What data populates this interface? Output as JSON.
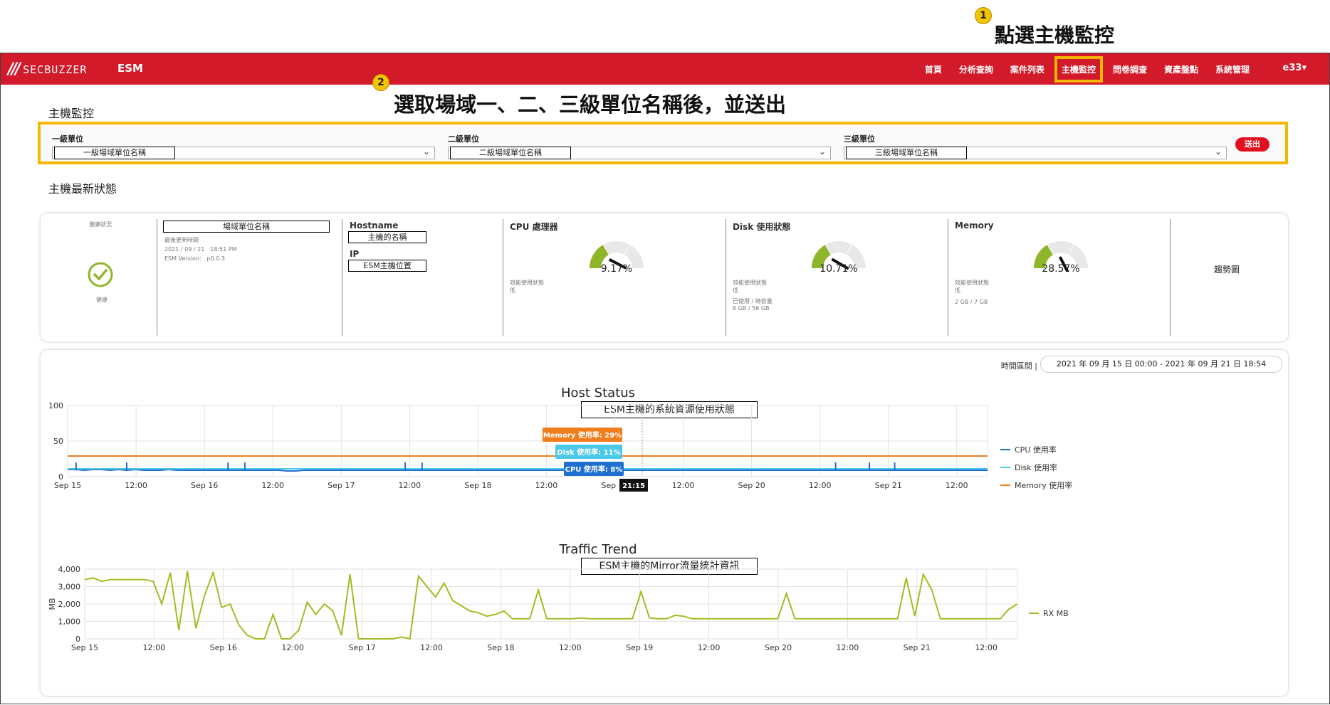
{
  "callouts": {
    "step1": {
      "num": "1",
      "text": "點選主機監控"
    },
    "step2": {
      "num": "2",
      "text": "選取場域一、二、三級單位名稱後，並送出"
    }
  },
  "header": {
    "logo_mark": "///",
    "logo_text": "SECBUZZER",
    "app_name": "ESM",
    "nav": [
      "首頁",
      "分析查詢",
      "案件列表",
      "主機監控",
      "問卷調查",
      "資產盤點",
      "系統管理"
    ],
    "active_nav": "主機監控",
    "user": "e33",
    "brand_color": "#d21a2a"
  },
  "page": {
    "title": "主機監控",
    "status_title": "主機最新狀態"
  },
  "filters": {
    "level1": {
      "label": "一級單位",
      "value": "一級場域單位名稱"
    },
    "level2": {
      "label": "二級單位",
      "value": "二級場域單位名稱"
    },
    "level3": {
      "label": "三級單位",
      "value": "三級場域單位名稱"
    },
    "submit": "送出"
  },
  "status": {
    "health_label": "健康狀況",
    "health_value": "健康",
    "unit_name": "場域單位名稱",
    "last_update_label": "最後更新時間",
    "last_update": "2021 / 09 / 21　18:51 PM",
    "esm_version": "ESM Version： p0.0.3",
    "hostname_label": "Hostname",
    "hostname_value": "主機的名稱",
    "ip_label": "IP",
    "ip_value": "ESM主機位置",
    "cpu": {
      "label": "CPU 處理器",
      "value": "9.17%",
      "percent": 9.17,
      "eff_label": "效能使用狀態",
      "eff_value": "低"
    },
    "disk": {
      "label": "Disk 使用狀態",
      "value": "10.71%",
      "percent": 10.71,
      "eff_label": "效能使用狀態",
      "eff_value": "低",
      "usage_label": "已使用 / 總容量",
      "usage_value": "6 GB / 56 GB"
    },
    "memory": {
      "label": "Memory",
      "value": "28.57%",
      "percent": 28.57,
      "eff_label": "效能使用狀態",
      "eff_value": "低",
      "usage_value": "2 GB / 7 GB"
    },
    "trend": "趨勢圖"
  },
  "range": {
    "label": "時間區間",
    "value": "2021 年 09 月 15 日 00:00 - 2021 年 09 月 21 日 18:54"
  },
  "chart_data": [
    {
      "type": "line",
      "title": "Host Status",
      "subtitle": "ESM主機的系統資源使用狀態",
      "x_ticks": [
        "Sep 15",
        "12:00",
        "Sep 16",
        "12:00",
        "Sep 17",
        "12:00",
        "Sep 18",
        "12:00",
        "Sep 19",
        "12:00",
        "Sep 20",
        "12:00",
        "Sep 21",
        "12:00"
      ],
      "ylim": [
        0,
        100
      ],
      "y_ticks": [
        "0",
        "50",
        "100"
      ],
      "grid": true,
      "legend": "right",
      "series": [
        {
          "name": "CPU 使用率",
          "color": "#1f6fd1",
          "values": [
            10,
            10,
            9,
            10,
            10,
            9,
            10,
            9,
            10,
            9,
            9,
            9,
            10,
            9,
            9,
            9,
            9,
            9,
            9,
            9,
            9,
            9,
            9,
            9,
            9,
            9,
            8,
            8,
            9,
            9,
            9,
            9,
            9,
            9,
            9,
            9,
            9,
            9,
            9,
            9,
            9,
            9,
            9,
            9,
            9,
            9,
            9,
            9,
            9,
            9,
            9,
            9,
            9,
            9,
            9,
            9,
            9,
            9,
            9,
            9,
            9,
            9,
            9,
            9,
            9,
            9,
            9,
            9,
            9,
            9,
            9,
            9,
            9,
            9,
            9,
            9,
            9,
            9,
            9,
            9,
            9,
            9,
            9,
            9,
            9,
            9,
            9,
            9,
            9,
            9,
            9,
            9,
            9,
            9,
            9,
            9,
            9,
            9,
            9,
            9,
            9,
            9,
            9,
            9,
            9,
            9,
            9,
            9,
            9,
            9
          ]
        },
        {
          "name": "Disk 使用率",
          "color": "#4cc8e8",
          "values": [
            11,
            11,
            11,
            11,
            11,
            11,
            11,
            11,
            11,
            11,
            11,
            11,
            11,
            11,
            11,
            11,
            11,
            11,
            11,
            11,
            11,
            11,
            11,
            11,
            11,
            11,
            11,
            11,
            11,
            11,
            11,
            11,
            11,
            11,
            11,
            11,
            11,
            11,
            11,
            11,
            11,
            11,
            11,
            11,
            11,
            11,
            11,
            11,
            11,
            11,
            11,
            11,
            11,
            11,
            11,
            11,
            11,
            11,
            11,
            11,
            11,
            11,
            11,
            11,
            11,
            11,
            11,
            11,
            11,
            11,
            11,
            11,
            11,
            11,
            11,
            11,
            11,
            11,
            11,
            11,
            11,
            11,
            11,
            11,
            11,
            11,
            11,
            11,
            11,
            11,
            11,
            11,
            11,
            11,
            11,
            11,
            11,
            11,
            11,
            11,
            11,
            11,
            11,
            11,
            11,
            11,
            11,
            11,
            11,
            11
          ]
        },
        {
          "name": "Memory 使用率",
          "color": "#f07d1c",
          "values": [
            29,
            29,
            29,
            29,
            29,
            29,
            29,
            29,
            29,
            29,
            29,
            29,
            29,
            29,
            29,
            29,
            29,
            29,
            29,
            29,
            29,
            29,
            29,
            29,
            29,
            29,
            29,
            29,
            29,
            29,
            29,
            29,
            29,
            29,
            29,
            29,
            29,
            29,
            29,
            29,
            29,
            29,
            29,
            29,
            29,
            29,
            29,
            29,
            29,
            29,
            29,
            29,
            29,
            29,
            29,
            29,
            29,
            29,
            29,
            29,
            29,
            29,
            29,
            29,
            29,
            29,
            29,
            29,
            29,
            29,
            29,
            29,
            29,
            29,
            29,
            29,
            29,
            29,
            29,
            29,
            29,
            29,
            29,
            29,
            29,
            29,
            29,
            29,
            29,
            29,
            29,
            29,
            29,
            29,
            29,
            29,
            29,
            29,
            29,
            29,
            29,
            29,
            29,
            29,
            29,
            29,
            29,
            29,
            29,
            29
          ]
        }
      ],
      "spikes": [
        {
          "series": 0,
          "index": [
            1,
            7,
            19,
            21,
            40,
            42,
            59,
            61,
            91,
            95,
            98
          ]
        }
      ],
      "tooltip": {
        "time": "21:15",
        "memory": "Memory 使用率: 29%",
        "disk": "Disk 使用率: 11%",
        "cpu": "CPU 使用率: 8%"
      }
    },
    {
      "type": "line",
      "title": "Traffic Trend",
      "subtitle": "ESM主機的Mirror流量統計資訊",
      "x_ticks": [
        "Sep 15",
        "12:00",
        "Sep 16",
        "12:00",
        "Sep 17",
        "12:00",
        "Sep 18",
        "12:00",
        "Sep 19",
        "12:00",
        "Sep 20",
        "12:00",
        "Sep 21",
        "12:00"
      ],
      "ylabel": "MB",
      "ylim": [
        0,
        4000
      ],
      "y_ticks": [
        "0",
        "1,000",
        "2,000",
        "3,000",
        "4,000"
      ],
      "grid": true,
      "legend": "right",
      "series": [
        {
          "name": "RX MB",
          "color": "#9dbf22",
          "values": [
            3400,
            3500,
            3300,
            3400,
            3400,
            3400,
            3400,
            3400,
            3300,
            2000,
            3800,
            500,
            3900,
            600,
            2500,
            3800,
            1800,
            2000,
            800,
            200,
            0,
            0,
            1400,
            0,
            0,
            500,
            2100,
            1400,
            2000,
            1600,
            200,
            3700,
            0,
            0,
            0,
            0,
            0,
            100,
            0,
            3600,
            3000,
            2400,
            3200,
            2200,
            1900,
            1600,
            1500,
            1300,
            1400,
            1600,
            1150,
            1150,
            1150,
            2800,
            1150,
            1150,
            1150,
            1150,
            1200,
            1150,
            1150,
            1150,
            1150,
            1150,
            1150,
            2700,
            1200,
            1150,
            1150,
            1350,
            1300,
            1150,
            1150,
            1150,
            1150,
            1150,
            1150,
            1150,
            1150,
            1150,
            1150,
            1150,
            2600,
            1150,
            1150,
            1150,
            1150,
            1150,
            1150,
            1150,
            1150,
            1150,
            1150,
            1150,
            1150,
            1150,
            3500,
            1300,
            3700,
            2800,
            1150,
            1150,
            1150,
            1150,
            1150,
            1150,
            1150,
            1150,
            1700,
            2000
          ]
        }
      ]
    }
  ]
}
